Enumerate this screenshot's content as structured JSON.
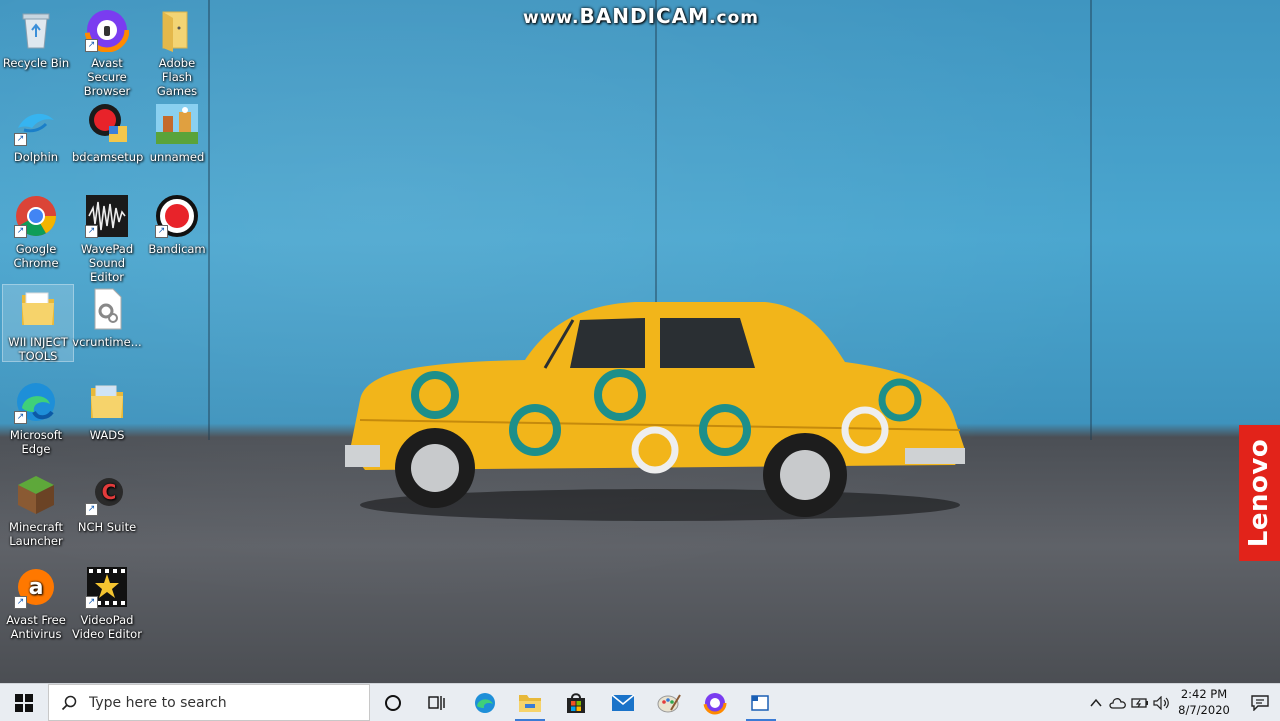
{
  "watermark": {
    "prefix": "www.",
    "brand": "BANDICAM",
    "suffix": ".com"
  },
  "desktop_icons": [
    {
      "label": "Recycle Bin",
      "icon": "recycle-bin-icon"
    },
    {
      "label": "Avast Secure Browser",
      "icon": "avast-secure-browser-icon"
    },
    {
      "label": "Adobe Flash Games",
      "icon": "folder-icon"
    },
    {
      "label": "Dolphin",
      "icon": "dolphin-icon"
    },
    {
      "label": "bdcamsetup",
      "icon": "bdcamsetup-icon"
    },
    {
      "label": "unnamed",
      "icon": "image-file-icon"
    },
    {
      "label": "Google Chrome",
      "icon": "chrome-icon"
    },
    {
      "label": "WavePad Sound Editor",
      "icon": "wavepad-icon"
    },
    {
      "label": "Bandicam",
      "icon": "bandicam-icon"
    },
    {
      "label": "WII INJECT TOOLS",
      "icon": "folder-icon"
    },
    {
      "label": "vcruntime...",
      "icon": "settings-file-icon"
    },
    {
      "label": "Microsoft Edge",
      "icon": "edge-icon"
    },
    {
      "label": "WADS",
      "icon": "folder-icon"
    },
    {
      "label": "Minecraft Launcher",
      "icon": "minecraft-icon"
    },
    {
      "label": "NCH Suite",
      "icon": "nch-suite-icon"
    },
    {
      "label": "Avast Free Antivirus",
      "icon": "avast-antivirus-icon"
    },
    {
      "label": "VideoPad Video Editor",
      "icon": "videopad-icon"
    }
  ],
  "wallpaper": {
    "brand_label": "Lenovo"
  },
  "taskbar": {
    "search_placeholder": "Type here to search",
    "apps": [
      "cortana-icon",
      "task-view-icon",
      "edge-icon",
      "file-explorer-icon",
      "store-icon",
      "mail-icon",
      "paint-icon",
      "avast-secure-browser-icon",
      "snipping-icon"
    ],
    "clock_time": "2:42 PM",
    "clock_date": "8/7/2020"
  },
  "colors": {
    "taskbar_bg": "#e9edf2",
    "accent": "#3a7bd5",
    "lenovo_red": "#e2231a",
    "car_yellow": "#f2b51a"
  }
}
